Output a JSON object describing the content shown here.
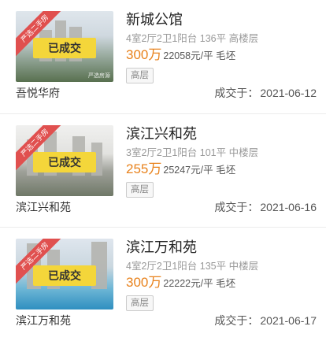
{
  "listings": [
    {
      "title": "新城公馆",
      "specs": "4室2厅2卫1阳台 136平 高楼层",
      "price": "300万",
      "unit_price": "22058元/平 毛坯",
      "tag": "高层",
      "community": "吾悦华府",
      "deal_label": "成交于：",
      "deal_date": "2021-06-12",
      "badge": "已成交",
      "ribbon": "严选二手房",
      "watermark": "严选房源"
    },
    {
      "title": "滨江兴和苑",
      "specs": "3室2厅2卫1阳台 101平 中楼层",
      "price": "255万",
      "unit_price": "25247元/平 毛坯",
      "tag": "高层",
      "community": "滨江兴和苑",
      "deal_label": "成交于：",
      "deal_date": "2021-06-16",
      "badge": "已成交",
      "ribbon": "严选二手房"
    },
    {
      "title": "滨江万和苑",
      "specs": "4室2厅2卫1阳台 135平 中楼层",
      "price": "300万",
      "unit_price": "22222元/平 毛坯",
      "tag": "高层",
      "community": "滨江万和苑",
      "deal_label": "成交于：",
      "deal_date": "2021-06-17",
      "badge": "已成交",
      "ribbon": "严选二手房"
    }
  ]
}
